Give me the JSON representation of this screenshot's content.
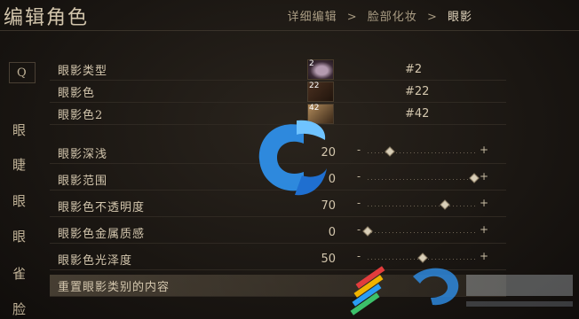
{
  "header": {
    "title": "编辑角色",
    "breadcrumb": [
      "详细编辑",
      "脸部化妆",
      "眼影"
    ],
    "sep": ">"
  },
  "sidebar": {
    "search_label": "Q",
    "items": [
      "眼",
      "睫",
      "眼",
      "眼",
      "雀",
      "脸"
    ]
  },
  "rows": [
    {
      "label": "眼影类型",
      "swatch": "2",
      "value": "#2"
    },
    {
      "label": "眼影色",
      "swatch": "22",
      "value": "#22"
    },
    {
      "label": "眼影色2",
      "swatch": "42",
      "value": "#42"
    },
    {
      "label": "眼影深浅",
      "num": "20",
      "level": 0.2
    },
    {
      "label": "眼影范围",
      "num": "0",
      "level": 0.97
    },
    {
      "label": "眼影色不透明度",
      "num": "70",
      "level": 0.7
    },
    {
      "label": "眼影色金属质感",
      "num": "0",
      "level": 0.0
    },
    {
      "label": "眼影色光泽度",
      "num": "50",
      "level": 0.5
    },
    {
      "label": "重置眼影类别的内容"
    }
  ],
  "slider_signs": {
    "minus": "-",
    "plus": "+"
  }
}
